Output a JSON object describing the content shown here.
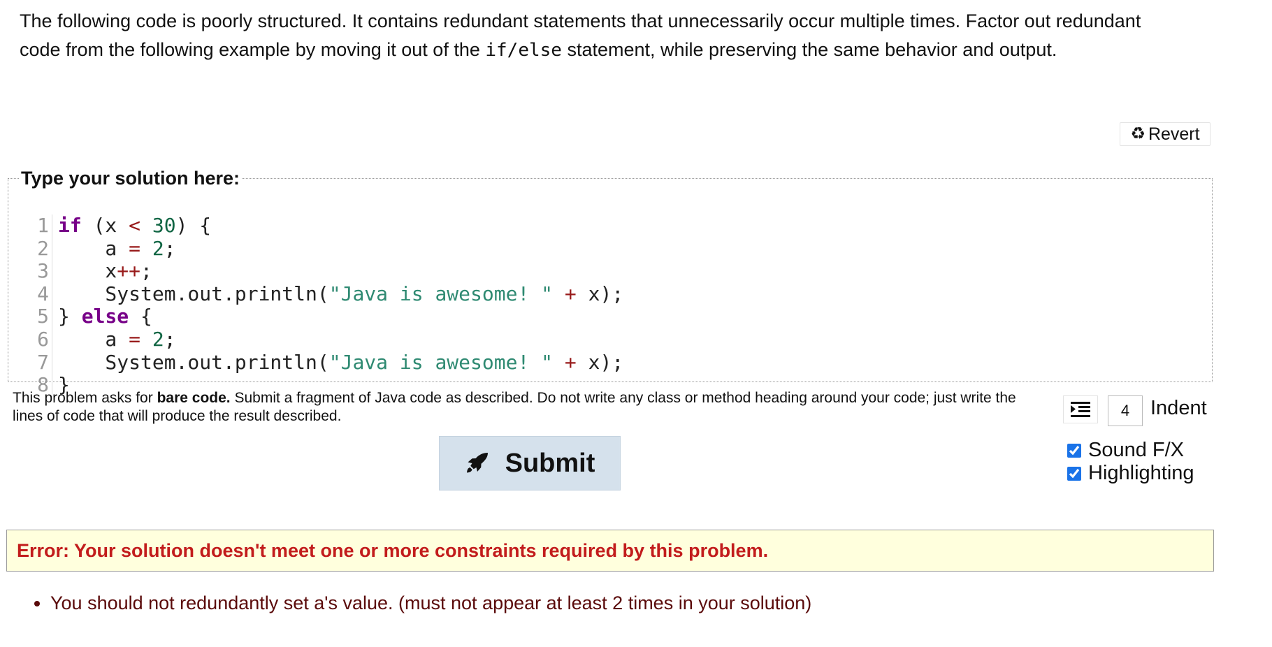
{
  "prompt": {
    "text_before": "The following code is poorly structured. It contains redundant statements that unnecessarily occur multiple times. Factor out redundant code from the following example by moving it out of the ",
    "code_term": "if/else",
    "text_after": " statement, while preserving the same behavior and output."
  },
  "revert": {
    "icon": "recycle-icon",
    "label": "Revert"
  },
  "editor": {
    "legend": "Type your solution here:",
    "lines": [
      {
        "n": "1",
        "tokens": [
          {
            "t": "if",
            "c": "kw"
          },
          {
            "t": " (x ",
            "c": "punct"
          },
          {
            "t": "<",
            "c": "op"
          },
          {
            "t": " ",
            "c": "punct"
          },
          {
            "t": "30",
            "c": "num"
          },
          {
            "t": ") {",
            "c": "punct"
          }
        ]
      },
      {
        "n": "2",
        "tokens": [
          {
            "t": "    a ",
            "c": "punct"
          },
          {
            "t": "=",
            "c": "op"
          },
          {
            "t": " ",
            "c": "punct"
          },
          {
            "t": "2",
            "c": "num"
          },
          {
            "t": ";",
            "c": "punct"
          }
        ]
      },
      {
        "n": "3",
        "tokens": [
          {
            "t": "    x",
            "c": "punct"
          },
          {
            "t": "++",
            "c": "op"
          },
          {
            "t": ";",
            "c": "punct"
          }
        ]
      },
      {
        "n": "4",
        "tokens": [
          {
            "t": "    System.out.println(",
            "c": "punct"
          },
          {
            "t": "\"Java is awesome! \"",
            "c": "str"
          },
          {
            "t": " ",
            "c": "punct"
          },
          {
            "t": "+",
            "c": "op"
          },
          {
            "t": " x);",
            "c": "punct"
          }
        ]
      },
      {
        "n": "5",
        "tokens": [
          {
            "t": "} ",
            "c": "punct"
          },
          {
            "t": "else",
            "c": "kw"
          },
          {
            "t": " {",
            "c": "punct"
          }
        ]
      },
      {
        "n": "6",
        "tokens": [
          {
            "t": "    a ",
            "c": "punct"
          },
          {
            "t": "=",
            "c": "op"
          },
          {
            "t": " ",
            "c": "punct"
          },
          {
            "t": "2",
            "c": "num"
          },
          {
            "t": ";",
            "c": "punct"
          }
        ]
      },
      {
        "n": "7",
        "tokens": [
          {
            "t": "    System.out.println(",
            "c": "punct"
          },
          {
            "t": "\"Java is awesome! \"",
            "c": "str"
          },
          {
            "t": " ",
            "c": "punct"
          },
          {
            "t": "+",
            "c": "op"
          },
          {
            "t": " x);",
            "c": "punct"
          }
        ]
      },
      {
        "n": "8",
        "tokens": [
          {
            "t": "}",
            "c": "punct"
          }
        ]
      }
    ]
  },
  "note": {
    "before": "This problem asks for ",
    "bold": "bare code.",
    "after": " Submit a fragment of Java code as described. Do not write any class or method heading around your code; just write the lines of code that will produce the result described."
  },
  "submit": {
    "icon": "rocket-icon",
    "label": "Submit"
  },
  "settings": {
    "indent_icon": "indent-icon",
    "indent_value": "4",
    "indent_label": "Indent",
    "sound_fx": {
      "label": "Sound F/X",
      "checked": true
    },
    "highlighting": {
      "label": "Highlighting",
      "checked": true
    }
  },
  "error": {
    "title": "Error: Your solution doesn't meet one or more constraints required by this problem.",
    "items": [
      "You should not redundantly set a's value. (must not appear at least 2 times in your solution)"
    ]
  },
  "colors": {
    "keyword": "#770088",
    "number": "#116644",
    "string": "#2f8a72",
    "operator": "#981a1a",
    "submit_bg": "#d5e1ec",
    "error_text": "#c21c1c",
    "error_bg": "#ffffdd"
  }
}
